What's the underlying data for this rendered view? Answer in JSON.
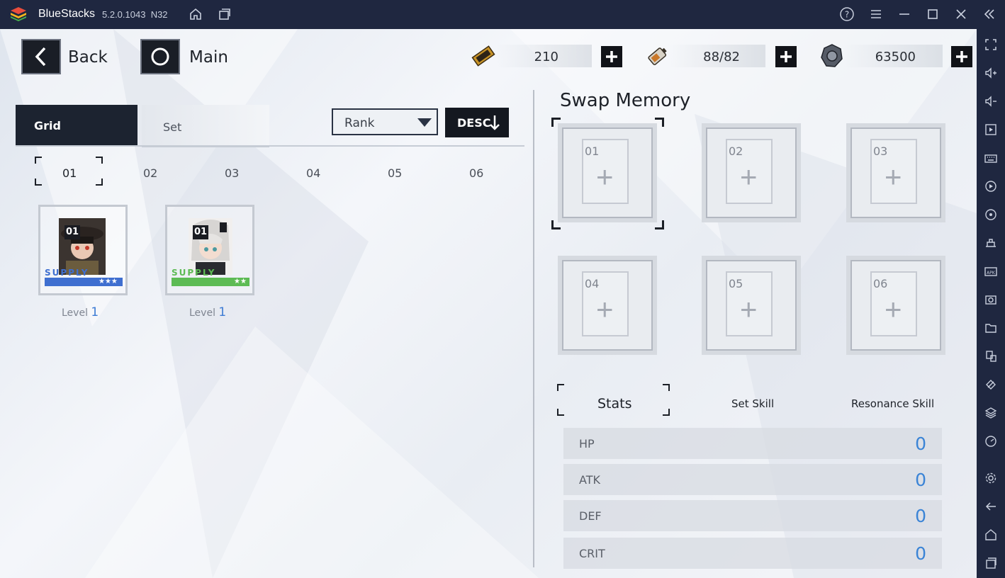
{
  "window": {
    "app_name": "BlueStacks",
    "version": "5.2.0.1043",
    "arch": "N32"
  },
  "header": {
    "back_label": "Back",
    "main_label": "Main",
    "resources": [
      {
        "icon": "gold-ticket-icon",
        "value": "210"
      },
      {
        "icon": "battery-icon",
        "value": "88/82"
      },
      {
        "icon": "gear-coin-icon",
        "value": "63500"
      }
    ]
  },
  "left_panel": {
    "tabs": {
      "grid": "Grid",
      "set": "Set"
    },
    "sort": {
      "selected": "Rank",
      "order_label": "DESC"
    },
    "number_tabs": [
      "01",
      "02",
      "03",
      "04",
      "05",
      "06"
    ],
    "cards": [
      {
        "id": "01",
        "badge": "SUPPLY",
        "stars": "★★★",
        "level_label": "Level",
        "level": "1",
        "color": "#3f6fd0"
      },
      {
        "id": "01",
        "badge": "SUPPLY",
        "stars": "★★",
        "level_label": "Level",
        "level": "1",
        "color": "#5dbb54"
      }
    ]
  },
  "right_panel": {
    "title": "Swap Memory",
    "slots": [
      "01",
      "02",
      "03",
      "04",
      "05",
      "06"
    ],
    "stat_tabs": [
      "Stats",
      "Set Skill",
      "Resonance Skill"
    ],
    "stats": [
      {
        "label": "HP",
        "value": "0"
      },
      {
        "label": "ATK",
        "value": "0"
      },
      {
        "label": "DEF",
        "value": "0"
      },
      {
        "label": "CRIT",
        "value": "0"
      }
    ]
  },
  "colors": {
    "accent_blue": "#3b84d6",
    "dark": "#1c2330",
    "titlebar": "#1f2740"
  }
}
